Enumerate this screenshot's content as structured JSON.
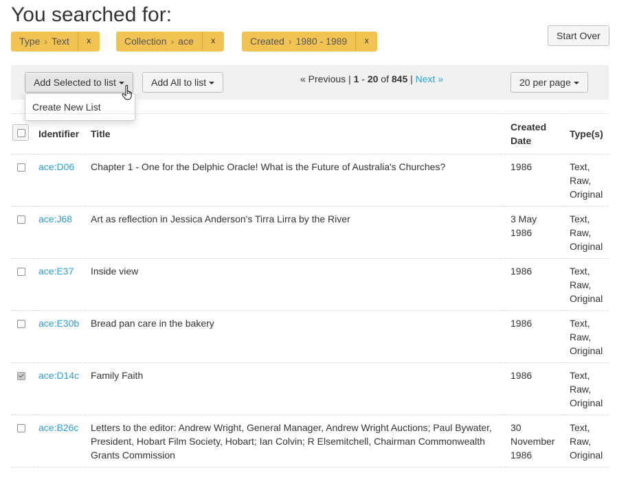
{
  "heading": "You searched for:",
  "constraints": [
    {
      "field": "Type",
      "value": "Text",
      "remove": "x"
    },
    {
      "field": "Collection",
      "value": "ace",
      "remove": "x"
    },
    {
      "field": "Created",
      "value": "1980 - 1989",
      "remove": "x"
    }
  ],
  "start_over": "Start Over",
  "toolbar": {
    "add_selected": "Add Selected to list",
    "add_all": "Add All to list",
    "per_page": "20 per page",
    "dropdown_item": "Create New List"
  },
  "pager": {
    "previous": "« Previous",
    "separator": "|",
    "range_start": "1",
    "dash": "-",
    "range_end": "20",
    "of": "of",
    "total": "845",
    "next": "Next »"
  },
  "table": {
    "headers": {
      "identifier": "Identifier",
      "title": "Title",
      "created_line1": "Created",
      "created_line2": "Date",
      "types": "Type(s)"
    },
    "rows": [
      {
        "id": "ace:D06",
        "title": "Chapter 1 - One for the Delphic Oracle! What is the Future of Australia's Churches?",
        "date": "1986",
        "types": [
          "Text,",
          "Raw,",
          "Original"
        ],
        "checked": false
      },
      {
        "id": "ace:J68",
        "title": "Art as reflection in Jessica Anderson's Tirra Lirra by the River",
        "date": "3 May 1986",
        "types": [
          "Text,",
          "Raw,",
          "Original"
        ],
        "checked": false
      },
      {
        "id": "ace:E37",
        "title": "Inside view",
        "date": "1986",
        "types": [
          "Text,",
          "Raw,",
          "Original"
        ],
        "checked": false
      },
      {
        "id": "ace:E30b",
        "title": "Bread pan care in the bakery",
        "date": "1986",
        "types": [
          "Text,",
          "Raw,",
          "Original"
        ],
        "checked": false
      },
      {
        "id": "ace:D14c",
        "title": "Family Faith",
        "date": "1986",
        "types": [
          "Text,",
          "Raw,",
          "Original"
        ],
        "checked": true
      },
      {
        "id": "ace:B26c",
        "title": "Letters to the editor: Andrew Wright, General Manager, Andrew Wright Auctions; Paul Bywater, President, Hobart Film Society, Hobart; Ian Colvin; R Elsemitchell, Chairman Commonwealth Grants Commission",
        "date": "30 November 1986",
        "types": [
          "Text,",
          "Raw,",
          "Original"
        ],
        "checked": false
      }
    ]
  },
  "colors": {
    "constraint_bg": "#f0c353",
    "link": "#2a9fd6",
    "toolbar_bg": "#f0f0f0"
  }
}
